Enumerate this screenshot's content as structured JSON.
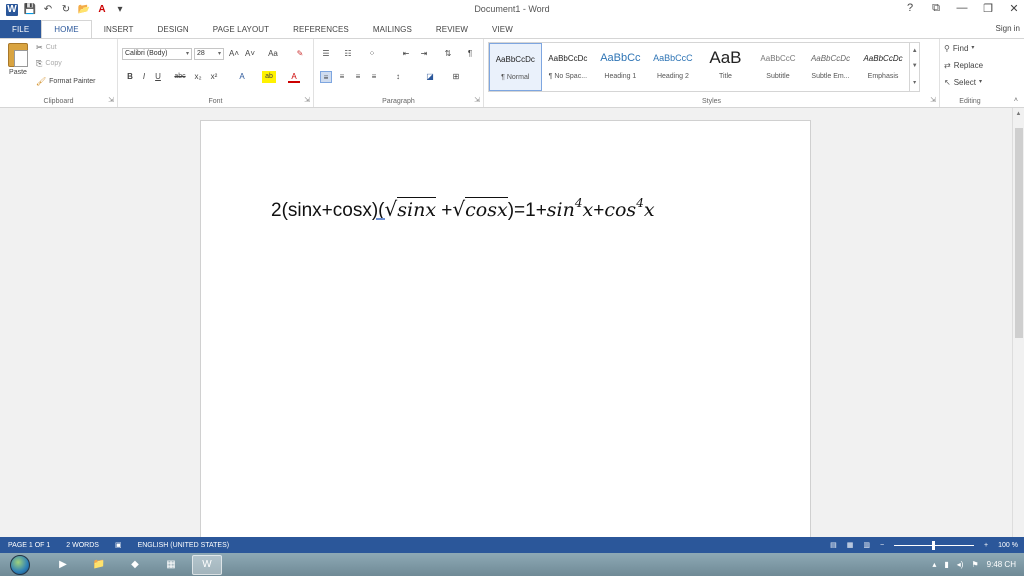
{
  "window": {
    "title": "Document1 - Word",
    "help": "?",
    "controls": [
      "⧉",
      "—",
      "❐",
      "✕"
    ]
  },
  "qat": [
    "W",
    "💾",
    "↶",
    "↻",
    "📂",
    "A",
    "▾"
  ],
  "tabs": [
    "FILE",
    "HOME",
    "INSERT",
    "DESIGN",
    "PAGE LAYOUT",
    "REFERENCES",
    "MAILINGS",
    "REVIEW",
    "VIEW"
  ],
  "signin": "Sign in",
  "clipboard": {
    "label": "Clipboard",
    "paste": "Paste",
    "cut": "Cut",
    "copy": "Copy",
    "format_painter": "Format Painter"
  },
  "font": {
    "label": "Font",
    "name": "Calibri (Body)",
    "size": "28",
    "row1": [
      "A˄",
      "A˅",
      "Aa",
      "✎"
    ],
    "row2": [
      "B",
      "I",
      "U",
      "abc",
      "x₂",
      "x²",
      "A",
      "ab",
      "A"
    ]
  },
  "paragraph": {
    "label": "Paragraph",
    "row1": [
      "☰",
      "☷",
      "⁘",
      "⇤",
      "⇥",
      "⇅",
      "¶"
    ],
    "row2": [
      "≡",
      "≡",
      "≡",
      "≡",
      "↕",
      "◪",
      "⊞"
    ]
  },
  "styles": {
    "label": "Styles",
    "items": [
      {
        "sample": "AaBbCcDc",
        "name": "¶ Normal"
      },
      {
        "sample": "AaBbCcDc",
        "name": "¶ No Spac..."
      },
      {
        "sample": "AaBbCc",
        "name": "Heading 1"
      },
      {
        "sample": "AaBbCcC",
        "name": "Heading 2"
      },
      {
        "sample": "AaB",
        "name": "Title"
      },
      {
        "sample": "AaBbCcC",
        "name": "Subtitle"
      },
      {
        "sample": "AaBbCcDc",
        "name": "Subtle Em..."
      },
      {
        "sample": "AaBbCcDc",
        "name": "Emphasis"
      }
    ]
  },
  "editing": {
    "label": "Editing",
    "find": "Find",
    "replace": "Replace",
    "select": "Select"
  },
  "document": {
    "eq_prefix": "2(sinx+cosx)(",
    "sqrt1": "sinx",
    "plus": " +",
    "sqrt2": "cosx",
    "eq_mid": ")=1+",
    "term1": "sin",
    "exp1": "4",
    "var1": "x",
    "plus2": "+",
    "term2": "cos",
    "exp2": "4",
    "var2": "x"
  },
  "status": {
    "page": "PAGE 1 OF 1",
    "words": "2 WORDS",
    "language": "ENGLISH (UNITED STATES)",
    "zoom": "100 %",
    "zoom_minus": "−",
    "zoom_plus": "+"
  },
  "taskbar": {
    "time": "9:48 CH"
  }
}
